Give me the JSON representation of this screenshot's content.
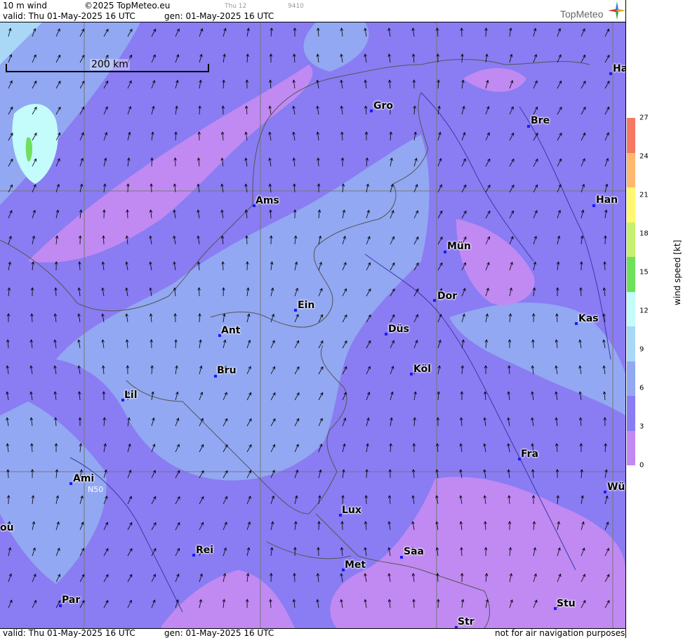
{
  "header": {
    "product": "10 m wind",
    "copyright": "©2025 TopMeteo.eu",
    "run_small": "Thu 12",
    "id_small": "9410",
    "valid": "valid:  Thu  01-May-2025  16 UTC",
    "gen": "gen: 01-May-2025 16 UTC",
    "logo": "TopMeteo"
  },
  "footer": {
    "valid": "valid:  Thu  01-May-2025  16 UTC",
    "gen": "gen: 01-May-2025 16 UTC",
    "disclaimer": "not for air navigation purposes"
  },
  "scale": {
    "label": "200 km"
  },
  "grid_label": "N50",
  "cities": [
    {
      "name": "Ha"
    },
    {
      "name": "Gro"
    },
    {
      "name": "Bre"
    },
    {
      "name": "Ams"
    },
    {
      "name": "Han"
    },
    {
      "name": "Mün"
    },
    {
      "name": "Dor"
    },
    {
      "name": "Ein"
    },
    {
      "name": "Kas"
    },
    {
      "name": "Ant"
    },
    {
      "name": "Düs"
    },
    {
      "name": "Köl"
    },
    {
      "name": "Bru"
    },
    {
      "name": "Lil"
    },
    {
      "name": "Fra"
    },
    {
      "name": "Ami"
    },
    {
      "name": "Wür"
    },
    {
      "name": "Lux"
    },
    {
      "name": "ou"
    },
    {
      "name": "Rei"
    },
    {
      "name": "Saa"
    },
    {
      "name": "Met"
    },
    {
      "name": "Par"
    },
    {
      "name": "Stu"
    },
    {
      "name": "Str"
    }
  ],
  "legend": {
    "title": "wind  speed  [kt]",
    "ticks": [
      "0",
      "3",
      "6",
      "9",
      "12",
      "15",
      "18",
      "21",
      "24",
      "27"
    ],
    "colors": [
      "#c08af2",
      "#8a7cf2",
      "#92a8f2",
      "#a8d8f6",
      "#c4fbfb",
      "#6ee05c",
      "#c8f070",
      "#fff870",
      "#ffb870",
      "#f47864"
    ]
  }
}
